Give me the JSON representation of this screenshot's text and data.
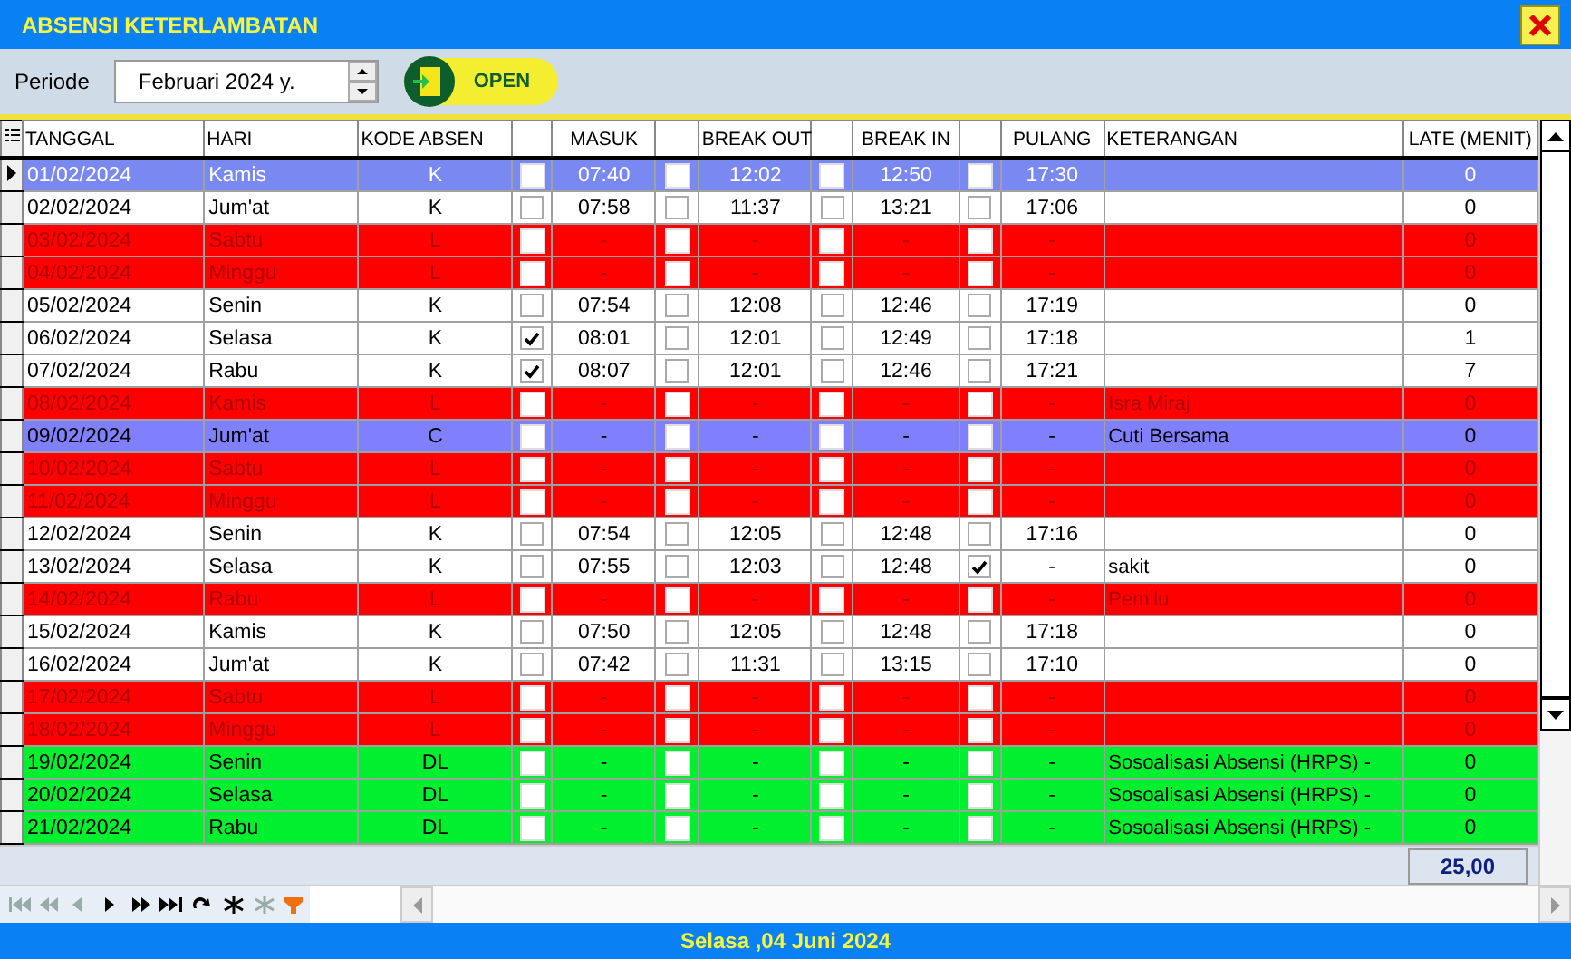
{
  "window": {
    "title": "ABSENSI KETERLAMBATAN"
  },
  "toolbar": {
    "label": "Periode",
    "period": "Februari 2024 y.",
    "open_button": "OPEN"
  },
  "table": {
    "columns": [
      "TANGGAL",
      "HARI",
      "KODE ABSEN",
      "",
      "MASUK",
      "",
      "BREAK OUT",
      "",
      "BREAK IN",
      "",
      "PULANG",
      "KETERANGAN",
      "LATE (MENIT)"
    ],
    "rows": [
      {
        "kind": "work",
        "selected": true,
        "date": "01/02/2024",
        "day": "Kamis",
        "code": "K",
        "checks": [
          false,
          false,
          false,
          false
        ],
        "masuk": "07:40",
        "break_out": "12:02",
        "break_in": "12:50",
        "pulang": "17:30",
        "note": "",
        "late": "0"
      },
      {
        "kind": "work",
        "selected": false,
        "date": "02/02/2024",
        "day": "Jum'at",
        "code": "K",
        "checks": [
          false,
          false,
          false,
          false
        ],
        "masuk": "07:58",
        "break_out": "11:37",
        "break_in": "13:21",
        "pulang": "17:06",
        "note": "",
        "late": "0"
      },
      {
        "kind": "holiday",
        "selected": false,
        "date": "03/02/2024",
        "day": "Sabtu",
        "code": "L",
        "checks": [
          false,
          false,
          false,
          false
        ],
        "masuk": "-",
        "break_out": "-",
        "break_in": "-",
        "pulang": "-",
        "note": "",
        "late": "0"
      },
      {
        "kind": "holiday",
        "selected": false,
        "date": "04/02/2024",
        "day": "Minggu",
        "code": "L",
        "checks": [
          false,
          false,
          false,
          false
        ],
        "masuk": "-",
        "break_out": "-",
        "break_in": "-",
        "pulang": "-",
        "note": "",
        "late": "0"
      },
      {
        "kind": "work",
        "selected": false,
        "date": "05/02/2024",
        "day": "Senin",
        "code": "K",
        "checks": [
          false,
          false,
          false,
          false
        ],
        "masuk": "07:54",
        "break_out": "12:08",
        "break_in": "12:46",
        "pulang": "17:19",
        "note": "",
        "late": "0"
      },
      {
        "kind": "work",
        "selected": false,
        "date": "06/02/2024",
        "day": "Selasa",
        "code": "K",
        "checks": [
          true,
          false,
          false,
          false
        ],
        "masuk": "08:01",
        "break_out": "12:01",
        "break_in": "12:49",
        "pulang": "17:18",
        "note": "",
        "late": "1"
      },
      {
        "kind": "work",
        "selected": false,
        "date": "07/02/2024",
        "day": "Rabu",
        "code": "K",
        "checks": [
          true,
          false,
          false,
          false
        ],
        "masuk": "08:07",
        "break_out": "12:01",
        "break_in": "12:46",
        "pulang": "17:21",
        "note": "",
        "late": "7"
      },
      {
        "kind": "holiday",
        "selected": false,
        "date": "08/02/2024",
        "day": "Kamis",
        "code": "L",
        "checks": [
          false,
          false,
          false,
          false
        ],
        "masuk": "-",
        "break_out": "-",
        "break_in": "-",
        "pulang": "-",
        "note": "Isra Miraj",
        "late": "0"
      },
      {
        "kind": "leave",
        "selected": false,
        "date": "09/02/2024",
        "day": "Jum'at",
        "code": "C",
        "checks": [
          false,
          false,
          false,
          false
        ],
        "masuk": "-",
        "break_out": "-",
        "break_in": "-",
        "pulang": "-",
        "note": "Cuti Bersama",
        "late": "0"
      },
      {
        "kind": "holiday",
        "selected": false,
        "date": "10/02/2024",
        "day": "Sabtu",
        "code": "L",
        "checks": [
          false,
          false,
          false,
          false
        ],
        "masuk": "-",
        "break_out": "-",
        "break_in": "-",
        "pulang": "-",
        "note": "",
        "late": "0"
      },
      {
        "kind": "holiday",
        "selected": false,
        "date": "11/02/2024",
        "day": "Minggu",
        "code": "L",
        "checks": [
          false,
          false,
          false,
          false
        ],
        "masuk": "-",
        "break_out": "-",
        "break_in": "-",
        "pulang": "-",
        "note": "",
        "late": "0"
      },
      {
        "kind": "work",
        "selected": false,
        "date": "12/02/2024",
        "day": "Senin",
        "code": "K",
        "checks": [
          false,
          false,
          false,
          false
        ],
        "masuk": "07:54",
        "break_out": "12:05",
        "break_in": "12:48",
        "pulang": "17:16",
        "note": "",
        "late": "0"
      },
      {
        "kind": "work",
        "selected": false,
        "date": "13/02/2024",
        "day": "Selasa",
        "code": "K",
        "checks": [
          false,
          false,
          false,
          true
        ],
        "masuk": "07:55",
        "break_out": "12:03",
        "break_in": "12:48",
        "pulang": "-",
        "note": "sakit",
        "late": "0"
      },
      {
        "kind": "holiday",
        "selected": false,
        "date": "14/02/2024",
        "day": "Rabu",
        "code": "L",
        "checks": [
          false,
          false,
          false,
          false
        ],
        "masuk": "-",
        "break_out": "-",
        "break_in": "-",
        "pulang": "-",
        "note": "Pemilu",
        "late": "0"
      },
      {
        "kind": "work",
        "selected": false,
        "date": "15/02/2024",
        "day": "Kamis",
        "code": "K",
        "checks": [
          false,
          false,
          false,
          false
        ],
        "masuk": "07:50",
        "break_out": "12:05",
        "break_in": "12:48",
        "pulang": "17:18",
        "note": "",
        "late": "0"
      },
      {
        "kind": "work",
        "selected": false,
        "date": "16/02/2024",
        "day": "Jum'at",
        "code": "K",
        "checks": [
          false,
          false,
          false,
          false
        ],
        "masuk": "07:42",
        "break_out": "11:31",
        "break_in": "13:15",
        "pulang": "17:10",
        "note": "",
        "late": "0"
      },
      {
        "kind": "holiday",
        "selected": false,
        "date": "17/02/2024",
        "day": "Sabtu",
        "code": "L",
        "checks": [
          false,
          false,
          false,
          false
        ],
        "masuk": "-",
        "break_out": "-",
        "break_in": "-",
        "pulang": "-",
        "note": "",
        "late": "0"
      },
      {
        "kind": "holiday",
        "selected": false,
        "date": "18/02/2024",
        "day": "Minggu",
        "code": "L",
        "checks": [
          false,
          false,
          false,
          false
        ],
        "masuk": "-",
        "break_out": "-",
        "break_in": "-",
        "pulang": "-",
        "note": "",
        "late": "0"
      },
      {
        "kind": "duty",
        "selected": false,
        "date": "19/02/2024",
        "day": "Senin",
        "code": "DL",
        "checks": [
          false,
          false,
          false,
          false
        ],
        "masuk": "-",
        "break_out": "-",
        "break_in": "-",
        "pulang": "-",
        "note": "Sosoalisasi Absensi (HRPS) -",
        "late": "0"
      },
      {
        "kind": "duty",
        "selected": false,
        "date": "20/02/2024",
        "day": "Selasa",
        "code": "DL",
        "checks": [
          false,
          false,
          false,
          false
        ],
        "masuk": "-",
        "break_out": "-",
        "break_in": "-",
        "pulang": "-",
        "note": "Sosoalisasi Absensi (HRPS) -",
        "late": "0"
      },
      {
        "kind": "duty",
        "selected": false,
        "date": "21/02/2024",
        "day": "Rabu",
        "code": "DL",
        "checks": [
          false,
          false,
          false,
          false
        ],
        "masuk": "-",
        "break_out": "-",
        "break_in": "-",
        "pulang": "-",
        "note": "Sosoalisasi Absensi (HRPS) -",
        "late": "0"
      }
    ],
    "total_late": "25,00"
  },
  "navigator": [
    {
      "kind": "first",
      "disabled": true
    },
    {
      "kind": "prior-page",
      "disabled": true
    },
    {
      "kind": "prior",
      "disabled": true
    },
    {
      "kind": "next",
      "disabled": false
    },
    {
      "kind": "next-page",
      "disabled": false
    },
    {
      "kind": "last",
      "disabled": false
    },
    {
      "kind": "refresh",
      "disabled": false
    },
    {
      "kind": "insert",
      "disabled": false
    },
    {
      "kind": "cancel",
      "disabled": true
    },
    {
      "kind": "filter",
      "disabled": false
    }
  ],
  "status_bar": "Selasa ,04 Juni 2024"
}
